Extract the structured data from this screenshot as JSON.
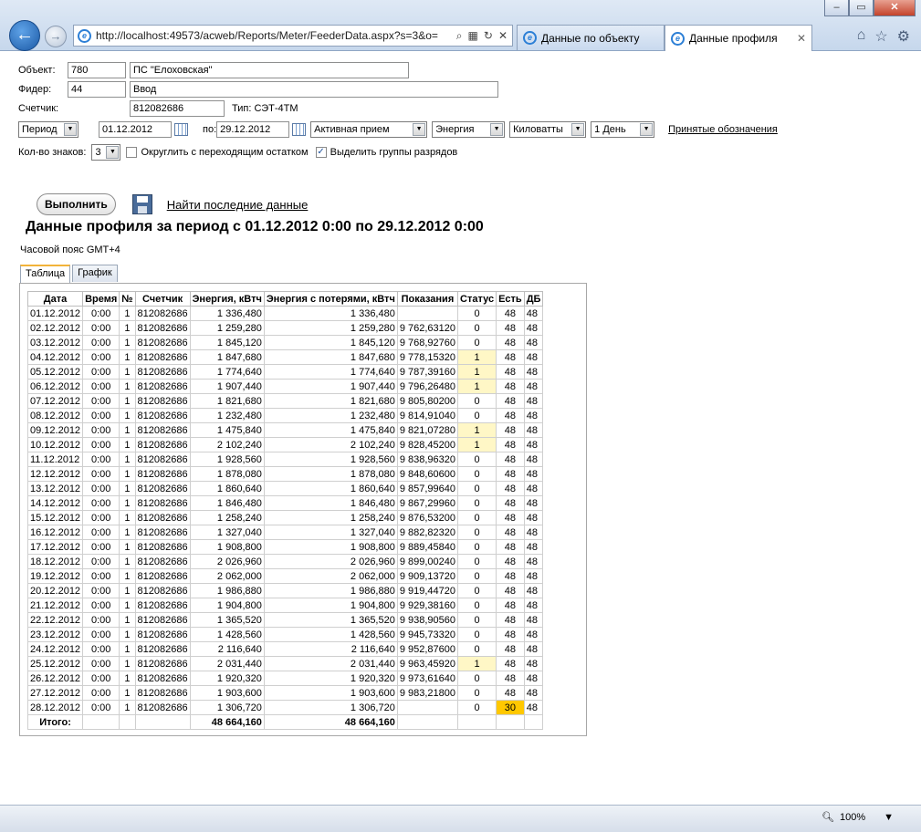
{
  "browser": {
    "url": "http://localhost:49573/acweb/Reports/Meter/FeederData.aspx?s=3&o=",
    "tabs": [
      {
        "label": "Данные по объекту"
      },
      {
        "label": "Данные профиля"
      }
    ],
    "zoom": "100%"
  },
  "form": {
    "object_label": "Объект:",
    "object_code": "780",
    "object_name": "ПС \"Елоховская\"",
    "feeder_label": "Фидер:",
    "feeder_code": "44",
    "feeder_name": "Ввод",
    "meter_label": "Счетчик:",
    "meter_number": "812082686",
    "meter_type": "Тип: СЭТ-4ТМ",
    "period_select": "Период",
    "date_from": "01.12.2012",
    "to_label": "по:",
    "date_to": "29.12.2012",
    "energy_type": "Активная прием",
    "quantity": "Энергия",
    "unit": "Киловатты",
    "interval": "1 День",
    "legend_link": "Принятые обозначения",
    "digits_label": "Кол-во знаков:",
    "digits": "3",
    "round_label": "Округлить с переходящим остатком",
    "group_label": "Выделить группы разрядов",
    "run_button": "Выполнить",
    "find_link": "Найти последние данные"
  },
  "report": {
    "title": "Данные профиля за период с 01.12.2012 0:00 по 29.12.2012 0:00",
    "timezone": "Часовой пояс GMT+4",
    "tabs": [
      "Таблица",
      "График"
    ]
  },
  "table": {
    "headers": [
      "Дата",
      "Время",
      "№",
      "Счетчик",
      "Энергия, кВтч",
      "Энергия с потерями, кВтч",
      "Показания",
      "Статус",
      "Есть",
      "ДБ"
    ],
    "rows": [
      [
        "01.12.2012",
        "0:00",
        "1",
        "812082686",
        "1 336,480",
        "1 336,480",
        "",
        "0",
        "48",
        "48"
      ],
      [
        "02.12.2012",
        "0:00",
        "1",
        "812082686",
        "1 259,280",
        "1 259,280",
        "9 762,63120",
        "0",
        "48",
        "48"
      ],
      [
        "03.12.2012",
        "0:00",
        "1",
        "812082686",
        "1 845,120",
        "1 845,120",
        "9 768,92760",
        "0",
        "48",
        "48"
      ],
      [
        "04.12.2012",
        "0:00",
        "1",
        "812082686",
        "1 847,680",
        "1 847,680",
        "9 778,15320",
        "1",
        "48",
        "48"
      ],
      [
        "05.12.2012",
        "0:00",
        "1",
        "812082686",
        "1 774,640",
        "1 774,640",
        "9 787,39160",
        "1",
        "48",
        "48"
      ],
      [
        "06.12.2012",
        "0:00",
        "1",
        "812082686",
        "1 907,440",
        "1 907,440",
        "9 796,26480",
        "1",
        "48",
        "48"
      ],
      [
        "07.12.2012",
        "0:00",
        "1",
        "812082686",
        "1 821,680",
        "1 821,680",
        "9 805,80200",
        "0",
        "48",
        "48"
      ],
      [
        "08.12.2012",
        "0:00",
        "1",
        "812082686",
        "1 232,480",
        "1 232,480",
        "9 814,91040",
        "0",
        "48",
        "48"
      ],
      [
        "09.12.2012",
        "0:00",
        "1",
        "812082686",
        "1 475,840",
        "1 475,840",
        "9 821,07280",
        "1",
        "48",
        "48"
      ],
      [
        "10.12.2012",
        "0:00",
        "1",
        "812082686",
        "2 102,240",
        "2 102,240",
        "9 828,45200",
        "1",
        "48",
        "48"
      ],
      [
        "11.12.2012",
        "0:00",
        "1",
        "812082686",
        "1 928,560",
        "1 928,560",
        "9 838,96320",
        "0",
        "48",
        "48"
      ],
      [
        "12.12.2012",
        "0:00",
        "1",
        "812082686",
        "1 878,080",
        "1 878,080",
        "9 848,60600",
        "0",
        "48",
        "48"
      ],
      [
        "13.12.2012",
        "0:00",
        "1",
        "812082686",
        "1 860,640",
        "1 860,640",
        "9 857,99640",
        "0",
        "48",
        "48"
      ],
      [
        "14.12.2012",
        "0:00",
        "1",
        "812082686",
        "1 846,480",
        "1 846,480",
        "9 867,29960",
        "0",
        "48",
        "48"
      ],
      [
        "15.12.2012",
        "0:00",
        "1",
        "812082686",
        "1 258,240",
        "1 258,240",
        "9 876,53200",
        "0",
        "48",
        "48"
      ],
      [
        "16.12.2012",
        "0:00",
        "1",
        "812082686",
        "1 327,040",
        "1 327,040",
        "9 882,82320",
        "0",
        "48",
        "48"
      ],
      [
        "17.12.2012",
        "0:00",
        "1",
        "812082686",
        "1 908,800",
        "1 908,800",
        "9 889,45840",
        "0",
        "48",
        "48"
      ],
      [
        "18.12.2012",
        "0:00",
        "1",
        "812082686",
        "2 026,960",
        "2 026,960",
        "9 899,00240",
        "0",
        "48",
        "48"
      ],
      [
        "19.12.2012",
        "0:00",
        "1",
        "812082686",
        "2 062,000",
        "2 062,000",
        "9 909,13720",
        "0",
        "48",
        "48"
      ],
      [
        "20.12.2012",
        "0:00",
        "1",
        "812082686",
        "1 986,880",
        "1 986,880",
        "9 919,44720",
        "0",
        "48",
        "48"
      ],
      [
        "21.12.2012",
        "0:00",
        "1",
        "812082686",
        "1 904,800",
        "1 904,800",
        "9 929,38160",
        "0",
        "48",
        "48"
      ],
      [
        "22.12.2012",
        "0:00",
        "1",
        "812082686",
        "1 365,520",
        "1 365,520",
        "9 938,90560",
        "0",
        "48",
        "48"
      ],
      [
        "23.12.2012",
        "0:00",
        "1",
        "812082686",
        "1 428,560",
        "1 428,560",
        "9 945,73320",
        "0",
        "48",
        "48"
      ],
      [
        "24.12.2012",
        "0:00",
        "1",
        "812082686",
        "2 116,640",
        "2 116,640",
        "9 952,87600",
        "0",
        "48",
        "48"
      ],
      [
        "25.12.2012",
        "0:00",
        "1",
        "812082686",
        "2 031,440",
        "2 031,440",
        "9 963,45920",
        "1",
        "48",
        "48"
      ],
      [
        "26.12.2012",
        "0:00",
        "1",
        "812082686",
        "1 920,320",
        "1 920,320",
        "9 973,61640",
        "0",
        "48",
        "48"
      ],
      [
        "27.12.2012",
        "0:00",
        "1",
        "812082686",
        "1 903,600",
        "1 903,600",
        "9 983,21800",
        "0",
        "48",
        "48"
      ],
      [
        "28.12.2012",
        "0:00",
        "1",
        "812082686",
        "1 306,720",
        "1 306,720",
        "",
        "0",
        "30",
        "48"
      ]
    ],
    "total": {
      "label": "Итого:",
      "energy": "48 664,160",
      "energy_losses": "48 664,160"
    },
    "colors": {
      "status_warn": "#fff7c6",
      "incomplete": "#ffc800"
    }
  }
}
